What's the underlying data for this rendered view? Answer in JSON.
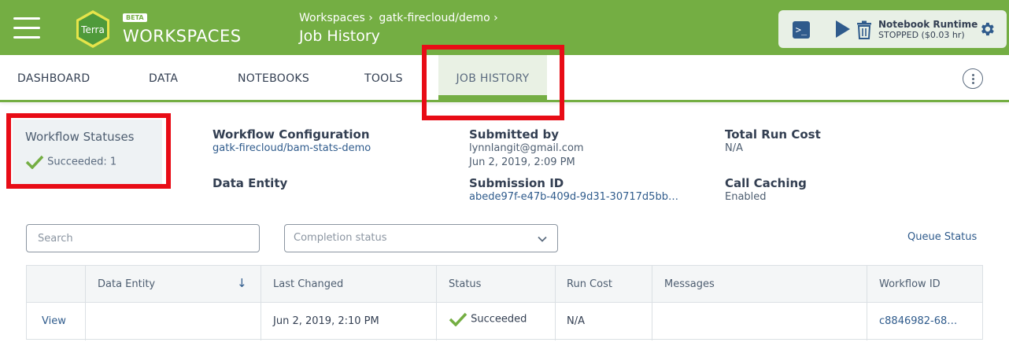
{
  "header": {
    "beta_badge": "BETA",
    "brand": "WORKSPACES",
    "logo_text": "Terra",
    "breadcrumbs": [
      "Workspaces ›",
      "gatk-firecloud/demo ›"
    ],
    "page_title": "Job History"
  },
  "runtime": {
    "terminal_glyph": ">_",
    "title": "Notebook Runtime",
    "status": "STOPPED ($0.03 hr)"
  },
  "tabs": [
    "DASHBOARD",
    "DATA",
    "NOTEBOOKS",
    "TOOLS"
  ],
  "active_tab": "JOB HISTORY",
  "summary": {
    "statuses_title": "Workflow Statuses",
    "succeeded": "Succeeded: 1",
    "workflow_config_label": "Workflow Configuration",
    "workflow_config_value": "gatk-firecloud/bam-stats-demo",
    "data_entity_label": "Data Entity",
    "submitted_by_label": "Submitted by",
    "submitted_by_email": "lynnlangit@gmail.com",
    "submitted_date": "Jun 2, 2019, 2:09 PM",
    "submission_id_label": "Submission ID",
    "submission_id_value": "abede97f-e47b-409d-9d31-30717d5bb…",
    "total_cost_label": "Total Run Cost",
    "total_cost_value": "N/A",
    "call_caching_label": "Call Caching",
    "call_caching_value": "Enabled"
  },
  "filters": {
    "search_placeholder": "Search",
    "completion_placeholder": "Completion status",
    "queue_status": "Queue Status"
  },
  "table": {
    "columns": [
      "Data Entity",
      "Last Changed",
      "Status",
      "Run Cost",
      "Messages",
      "Workflow ID"
    ],
    "sort_arrow": "↓",
    "row": {
      "view": "View",
      "data_entity": "",
      "last_changed": "Jun 2, 2019, 2:10 PM",
      "status": "Succeeded",
      "run_cost": "N/A",
      "messages": "",
      "workflow_id": "c8846982-68…"
    }
  },
  "colors": {
    "header_green": "#74ae43",
    "link_blue": "#2f5b8c",
    "success_green": "#74ae43",
    "highlight_red": "#e80c16"
  }
}
